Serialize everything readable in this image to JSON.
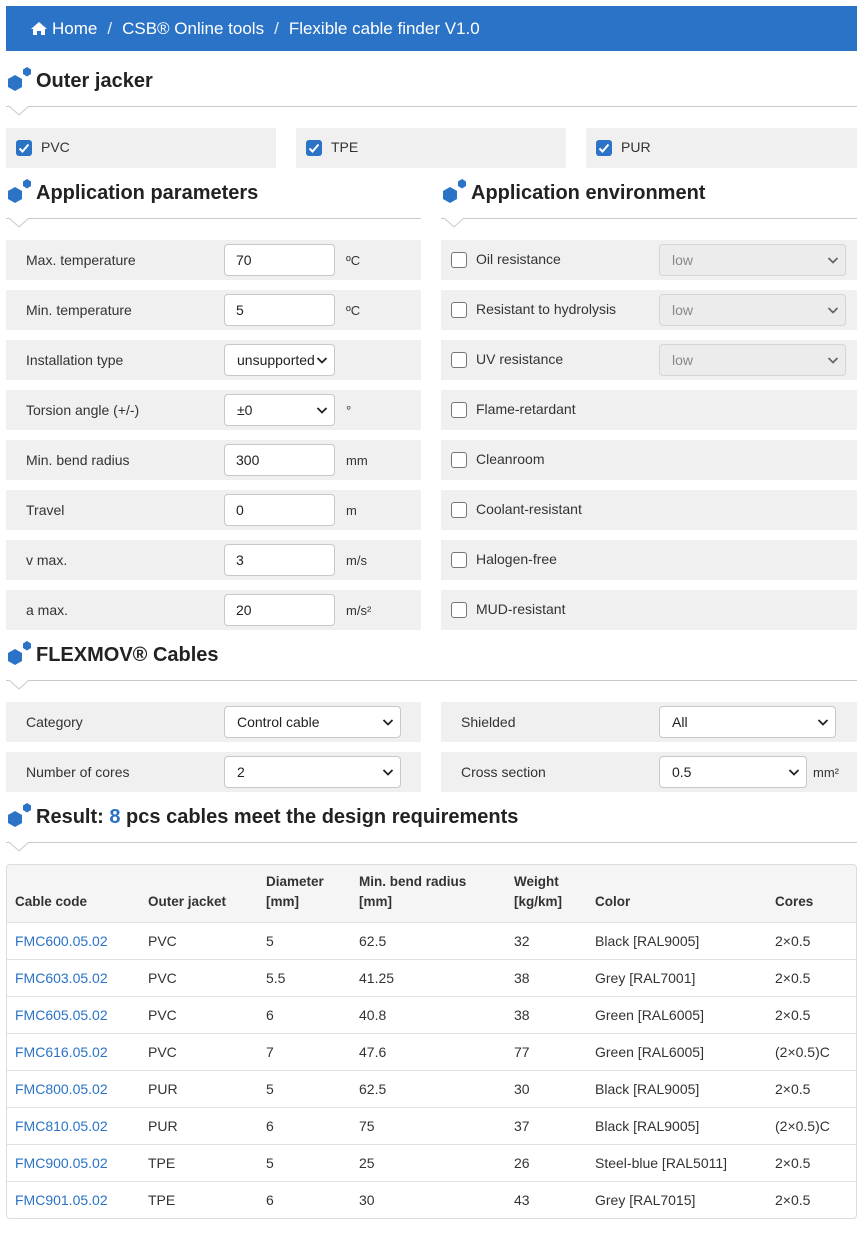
{
  "breadcrumb": {
    "home": "Home",
    "sep": "/",
    "level1": "CSB® Online tools",
    "level2": "Flexible cable finder V1.0"
  },
  "outer_jacket": {
    "title": "Outer jacker",
    "options": [
      {
        "label": "PVC",
        "checked": true
      },
      {
        "label": "TPE",
        "checked": true
      },
      {
        "label": "PUR",
        "checked": true
      }
    ]
  },
  "app_params": {
    "title": "Application parameters",
    "max_temp": {
      "label": "Max. temperature",
      "value": "70",
      "unit": "ºC"
    },
    "min_temp": {
      "label": "Min. temperature",
      "value": "5",
      "unit": "ºC"
    },
    "install_type": {
      "label": "Installation type",
      "value": "unsupported"
    },
    "torsion": {
      "label": "Torsion angle (+/-)",
      "value": "±0",
      "unit": "°"
    },
    "bend_radius": {
      "label": "Min. bend radius",
      "value": "300",
      "unit": "mm"
    },
    "travel": {
      "label": "Travel",
      "value": "0",
      "unit": "m"
    },
    "v_max": {
      "label": "v max.",
      "value": "3",
      "unit": "m/s"
    },
    "a_max": {
      "label": "a max.",
      "value": "20",
      "unit": "m/s²"
    }
  },
  "app_env": {
    "title": "Application environment",
    "items": [
      {
        "label": "Oil resistance",
        "checked": false,
        "select": "low"
      },
      {
        "label": "Resistant to hydrolysis",
        "checked": false,
        "select": "low"
      },
      {
        "label": "UV resistance",
        "checked": false,
        "select": "low"
      },
      {
        "label": "Flame-retardant",
        "checked": false
      },
      {
        "label": "Cleanroom",
        "checked": false
      },
      {
        "label": "Coolant-resistant",
        "checked": false
      },
      {
        "label": "Halogen-free",
        "checked": false
      },
      {
        "label": "MUD-resistant",
        "checked": false
      }
    ]
  },
  "flexmov": {
    "title": "FLEXMOV® Cables",
    "category": {
      "label": "Category",
      "value": "Control cable"
    },
    "shielded": {
      "label": "Shielded",
      "value": "All"
    },
    "cores": {
      "label": "Number of cores",
      "value": "2"
    },
    "cross_section": {
      "label": "Cross section",
      "value": "0.5",
      "unit": "mm²"
    }
  },
  "result": {
    "prefix": "Result:",
    "count": "8",
    "suffix": "pcs cables meet the design requirements",
    "columns": [
      "Cable code",
      "Outer jacket",
      "Diameter",
      "[mm]",
      "Min. bend radius",
      "[mm]",
      "Weight",
      "[kg/km]",
      "Color",
      "Cores"
    ],
    "rows": [
      {
        "code": "FMC600.05.02",
        "jacket": "PVC",
        "diameter": "5",
        "bend": "62.5",
        "weight": "32",
        "color": "Black [RAL9005]",
        "cores": "2×0.5"
      },
      {
        "code": "FMC603.05.02",
        "jacket": "PVC",
        "diameter": "5.5",
        "bend": "41.25",
        "weight": "38",
        "color": "Grey [RAL7001]",
        "cores": "2×0.5"
      },
      {
        "code": "FMC605.05.02",
        "jacket": "PVC",
        "diameter": "6",
        "bend": "40.8",
        "weight": "38",
        "color": "Green [RAL6005]",
        "cores": "2×0.5"
      },
      {
        "code": "FMC616.05.02",
        "jacket": "PVC",
        "diameter": "7",
        "bend": "47.6",
        "weight": "77",
        "color": "Green [RAL6005]",
        "cores": "(2×0.5)C"
      },
      {
        "code": "FMC800.05.02",
        "jacket": "PUR",
        "diameter": "5",
        "bend": "62.5",
        "weight": "30",
        "color": "Black [RAL9005]",
        "cores": "2×0.5"
      },
      {
        "code": "FMC810.05.02",
        "jacket": "PUR",
        "diameter": "6",
        "bend": "75",
        "weight": "37",
        "color": "Black [RAL9005]",
        "cores": "(2×0.5)C"
      },
      {
        "code": "FMC900.05.02",
        "jacket": "TPE",
        "diameter": "5",
        "bend": "25",
        "weight": "26",
        "color": "Steel-blue [RAL5011]",
        "cores": "2×0.5"
      },
      {
        "code": "FMC901.05.02",
        "jacket": "TPE",
        "diameter": "6",
        "bend": "30",
        "weight": "43",
        "color": "Grey [RAL7015]",
        "cores": "2×0.5"
      }
    ]
  },
  "colors": {
    "accent": "#2a73c6",
    "row_bg": "#f0f0f0"
  },
  "icons": {
    "home": "home-icon",
    "section": "hexagon-dots-icon",
    "check": "check-icon",
    "chevron": "chevron-down-icon"
  }
}
